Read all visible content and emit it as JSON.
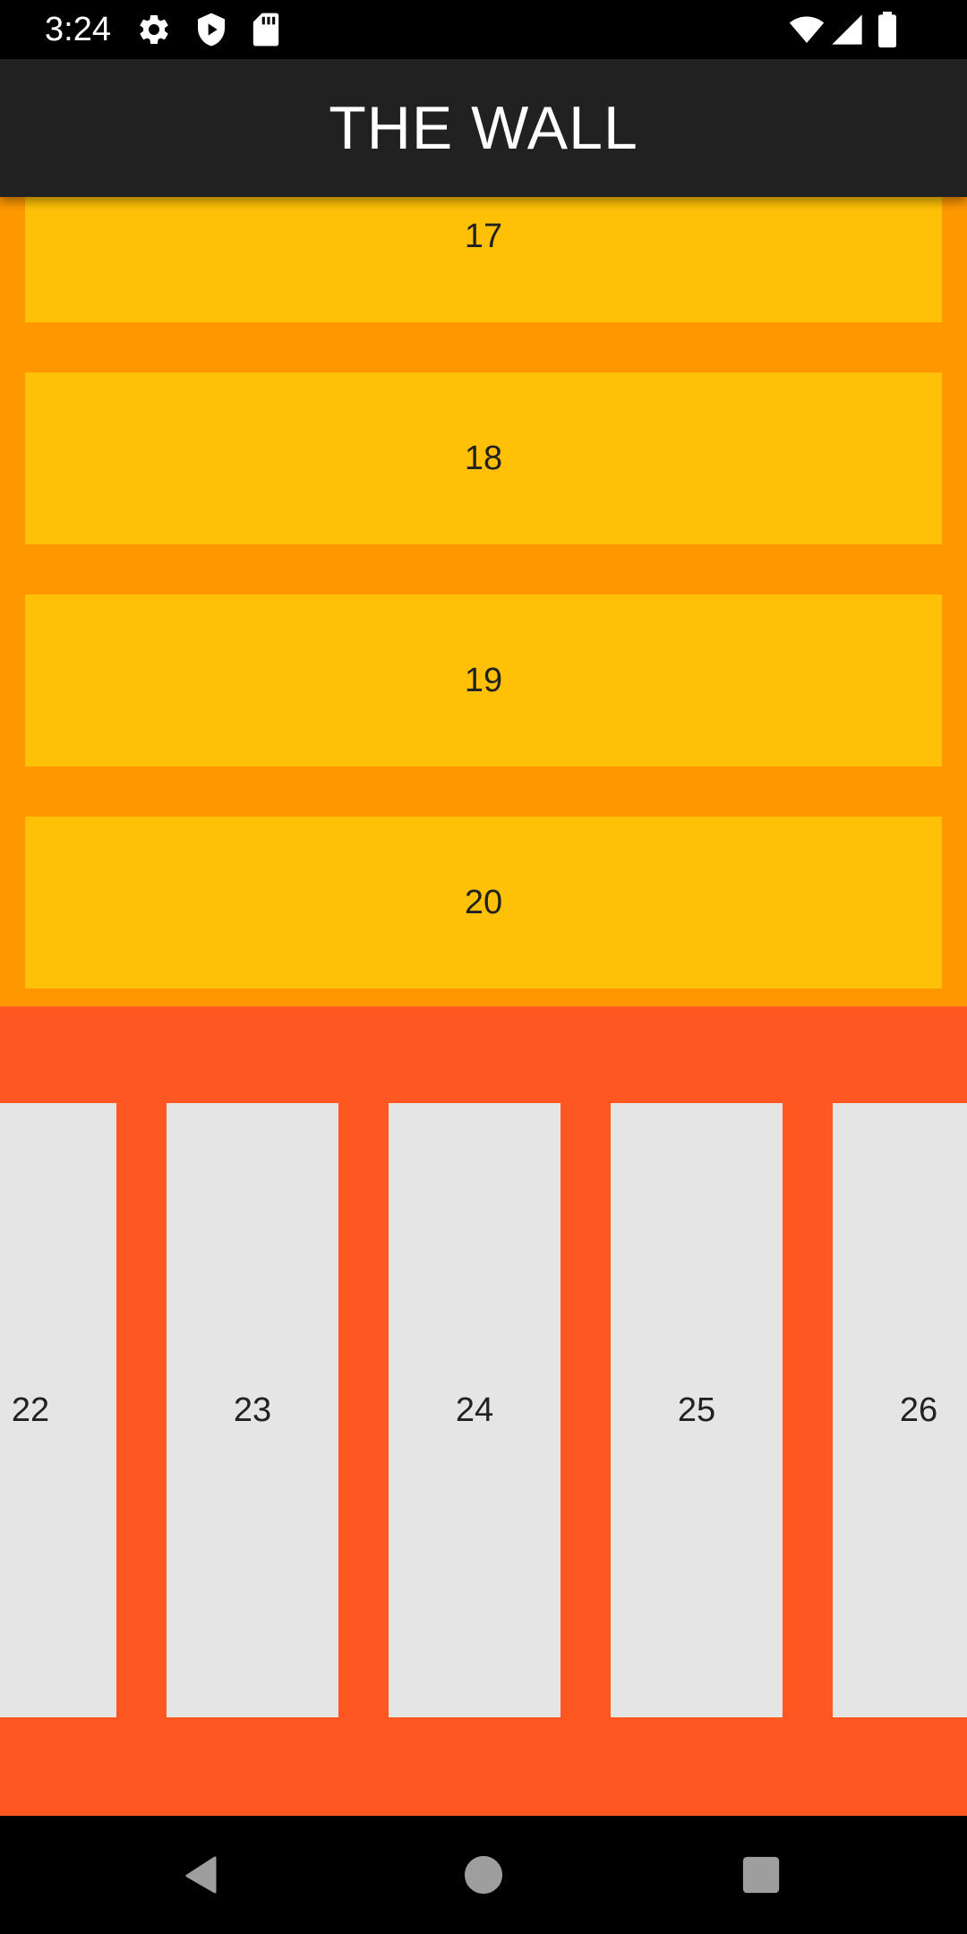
{
  "status_bar": {
    "time": "3:24",
    "left_icons": [
      "gear-icon",
      "shield-play-icon",
      "sd-card-icon"
    ],
    "right_icons": [
      "wifi-icon",
      "cell-signal-icon",
      "battery-icon"
    ]
  },
  "app_bar": {
    "title": "THE WALL",
    "background": "#212121"
  },
  "vertical_list": {
    "background": "#ff9800",
    "item_color": "#ffc107",
    "items": [
      {
        "label": "17"
      },
      {
        "label": "18"
      },
      {
        "label": "19"
      },
      {
        "label": "20"
      }
    ]
  },
  "horizontal_list": {
    "background": "#ff5722",
    "item_color": "#e5e5e5",
    "items": [
      {
        "label": "22"
      },
      {
        "label": "23"
      },
      {
        "label": "24"
      },
      {
        "label": "25"
      },
      {
        "label": "26"
      }
    ]
  },
  "nav_bar": {
    "buttons": [
      "back-icon",
      "home-icon",
      "recents-icon"
    ]
  }
}
